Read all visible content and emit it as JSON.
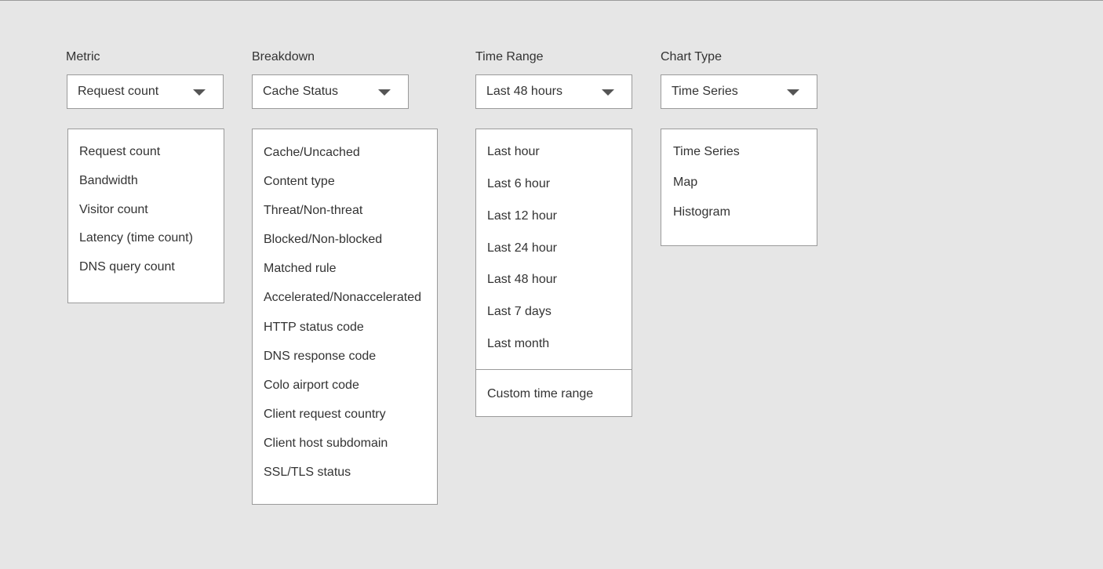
{
  "metric": {
    "label": "Metric",
    "selected": "Request count",
    "options": [
      "Request count",
      "Bandwidth",
      "Visitor count",
      "Latency (time count)",
      "DNS query count"
    ]
  },
  "breakdown": {
    "label": "Breakdown",
    "selected": "Cache Status",
    "options": [
      "Cache/Uncached",
      "Content type",
      "Threat/Non-threat",
      "Blocked/Non-blocked",
      "Matched rule",
      "Accelerated/Nonaccelerated",
      "HTTP status code",
      "DNS response code",
      "Colo airport code",
      "Client request country",
      "Client host subdomain",
      "SSL/TLS status"
    ]
  },
  "time_range": {
    "label": "Time Range",
    "selected": "Last 48 hours",
    "options": [
      "Last hour",
      "Last 6 hour",
      "Last 12 hour",
      "Last 24 hour",
      "Last 48 hour",
      "Last 7 days",
      "Last month"
    ],
    "custom": "Custom time range"
  },
  "chart_type": {
    "label": "Chart Type",
    "selected": "Time Series",
    "options": [
      "Time Series",
      "Map",
      "Histogram"
    ]
  }
}
